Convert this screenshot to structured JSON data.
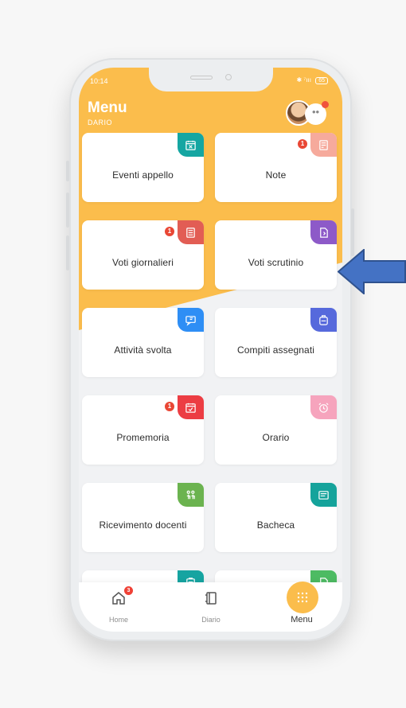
{
  "status_bar": {
    "time": "10:14",
    "signal": "✱ ⁷ııı",
    "battery": "65"
  },
  "header": {
    "title": "Menu",
    "subtitle": "DARIO",
    "more_label": "••"
  },
  "menu_items": [
    {
      "label": "Eventi appello",
      "icon": "calendar-x-icon",
      "color": "#15a6a2",
      "badge": null
    },
    {
      "label": "Note",
      "icon": "note-icon",
      "color": "#f6aa9c",
      "badge": "1"
    },
    {
      "label": "Voti giornalieri",
      "icon": "grades-icon",
      "color": "#e25d54",
      "badge": "1"
    },
    {
      "label": "Voti scrutinio",
      "icon": "scrutiny-icon",
      "color": "#8d5ac8",
      "badge": null
    },
    {
      "label": "Attività svolta",
      "icon": "activity-icon",
      "color": "#2e8ef5",
      "badge": null
    },
    {
      "label": "Compiti assegnati",
      "icon": "backpack-icon",
      "color": "#5669dc",
      "badge": null
    },
    {
      "label": "Promemoria",
      "icon": "calendar-check-icon",
      "color": "#ec3d43",
      "badge": "1"
    },
    {
      "label": "Orario",
      "icon": "alarm-clock-icon",
      "color": "#f6a4bd",
      "badge": null
    },
    {
      "label": "Ricevimento docenti",
      "icon": "meeting-icon",
      "color": "#6bb34f",
      "badge": null
    },
    {
      "label": "Bacheca",
      "icon": "board-icon",
      "color": "#15a39b",
      "badge": null
    },
    {
      "label": "",
      "icon": "clipboard-icon",
      "color": "#16a4a1",
      "badge": null
    },
    {
      "label": "",
      "icon": "document-icon",
      "color": "#4dbb63",
      "badge": null
    }
  ],
  "bottom_nav": [
    {
      "label": "Home",
      "icon": "home-icon",
      "badge": "3"
    },
    {
      "label": "Diario",
      "icon": "diary-icon",
      "badge": null
    },
    {
      "label": "Menu",
      "icon": "grid-dots-icon",
      "badge": null
    }
  ],
  "colors": {
    "accent": "#fbbd4c",
    "arrow": "#4472c4",
    "arrow_border": "#2f528f"
  }
}
